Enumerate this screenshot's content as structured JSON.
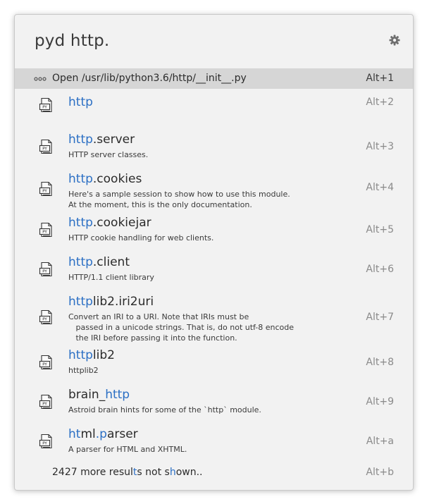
{
  "query": "pyd http.",
  "open_row": {
    "label": "Open /usr/lib/python3.6/http/__init__.py",
    "shortcut": "Alt+1"
  },
  "results": [
    {
      "pre": "",
      "hl": "http",
      "post": "",
      "desc": "",
      "shortcut": "Alt+2"
    },
    {
      "pre": "",
      "hl": "http",
      "post": ".server",
      "desc": "HTTP server classes.",
      "shortcut": "Alt+3"
    },
    {
      "pre": "",
      "hl": "http",
      "post": ".cookies",
      "desc": "Here's a sample session to show how to use this module.\nAt the moment, this is the only documentation.",
      "shortcut": "Alt+4"
    },
    {
      "pre": "",
      "hl": "http",
      "post": ".cookiejar",
      "desc": "HTTP cookie handling for web clients.",
      "shortcut": "Alt+5"
    },
    {
      "pre": "",
      "hl": "http",
      "post": ".client",
      "desc": "HTTP/1.1 client library",
      "shortcut": "Alt+6"
    },
    {
      "pre": "",
      "hl": "http",
      "post": "lib2.iri2uri",
      "desc": "Convert an IRI to a URI. Note that IRIs must be\n   passed in a unicode strings. That is, do not utf-8 encode\n   the IRI before passing it into the function.",
      "shortcut": "Alt+7"
    },
    {
      "pre": "",
      "hl": "http",
      "post": "lib2",
      "desc": "httplib2",
      "shortcut": "Alt+8"
    },
    {
      "pre": "brain_",
      "hl": "http",
      "post": "",
      "desc": "Astroid brain hints for some of the `http` module.",
      "shortcut": "Alt+9"
    },
    {
      "segments": [
        [
          "ht",
          true
        ],
        [
          "ml",
          false
        ],
        [
          ".p",
          true
        ],
        [
          "arser",
          false
        ]
      ],
      "desc": "A parser for HTML and XHTML.",
      "shortcut": "Alt+a"
    }
  ],
  "more": {
    "segments": [
      [
        "2427 more resul",
        false
      ],
      [
        "t",
        true
      ],
      [
        "s not s",
        false
      ],
      [
        "h",
        true
      ],
      [
        "own..",
        false
      ]
    ],
    "shortcut": "Alt+b"
  },
  "colors": {
    "highlight": "#2b6fc4",
    "selected_row": "#d6d6d6"
  },
  "icons": {
    "settings": "gear-icon",
    "open": "more-dots-icon",
    "result": "python-file-icon"
  }
}
